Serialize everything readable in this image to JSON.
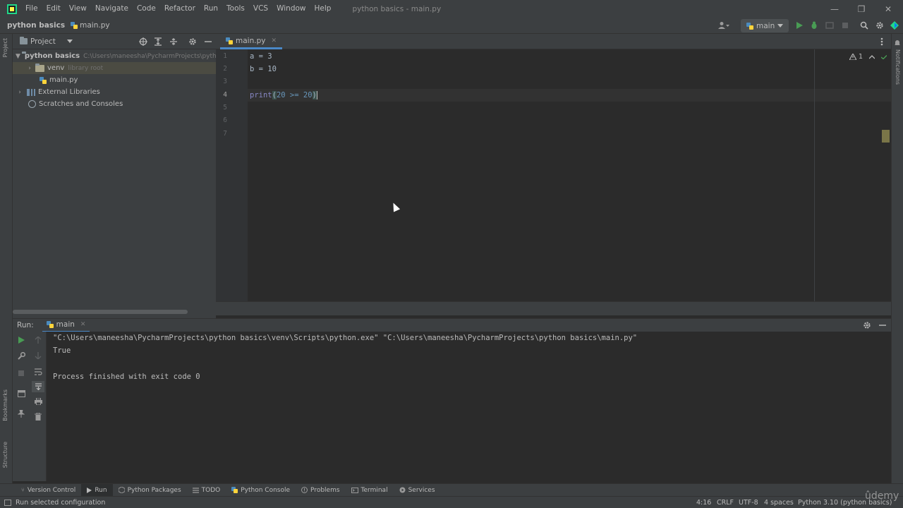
{
  "menubar": {
    "items": [
      "File",
      "Edit",
      "View",
      "Navigate",
      "Code",
      "Refactor",
      "Run",
      "Tools",
      "VCS",
      "Window",
      "Help"
    ],
    "window_title": "python basics - main.py",
    "minimize_glyph": "—",
    "restore_glyph": "❐",
    "close_glyph": "✕"
  },
  "navbar": {
    "project": "python basics",
    "file": "main.py",
    "run_config": "main",
    "icons": [
      "user-icon",
      "run-icon",
      "debug-icon",
      "coverage-icon",
      "stop-icon",
      "search-icon",
      "gear-icon",
      "jetbrains-icon"
    ]
  },
  "project_panel": {
    "title": "Project",
    "tree": [
      {
        "label": "python basics",
        "hint": "C:\\Users\\maneesha\\PycharmProjects\\pyth"
      },
      {
        "label": "venv",
        "hint": "library root"
      },
      {
        "label": "main.py",
        "hint": ""
      },
      {
        "label": "External Libraries",
        "hint": ""
      },
      {
        "label": "Scratches and Consoles",
        "hint": ""
      }
    ]
  },
  "left_stripe": {
    "project": "Project",
    "bookmarks": "Bookmarks",
    "structure": "Structure"
  },
  "right_stripe": {
    "notifications": "Notifications"
  },
  "editor": {
    "tab": "main.py",
    "line_numbers": [
      "1",
      "2",
      "3",
      "4",
      "5",
      "6",
      "7"
    ],
    "inspection_count": "1",
    "lines": {
      "l1": "a = 3",
      "l2": "b = 10",
      "l4_fn": "print",
      "l4_open": "(",
      "l4_expr": "20 >= 20",
      "l4_close": ")"
    }
  },
  "run_panel": {
    "label": "Run:",
    "tab": "main",
    "output": [
      "\"C:\\Users\\maneesha\\PycharmProjects\\python basics\\venv\\Scripts\\python.exe\" \"C:\\Users\\maneesha\\PycharmProjects\\python basics\\main.py\"",
      "True",
      "",
      "Process finished with exit code 0"
    ]
  },
  "tool_tabs": [
    "Version Control",
    "Run",
    "Python Packages",
    "TODO",
    "Python Console",
    "Problems",
    "Terminal",
    "Services"
  ],
  "statusbar": {
    "message": "Run selected configuration",
    "position": "4:16",
    "line_sep": "CRLF",
    "encoding": "UTF-8",
    "indent": "4 spaces",
    "interpreter": "Python 3.10 (python basics)"
  },
  "watermark": "ûdemy",
  "colors": {
    "keyword_fn": "#8888c6",
    "number": "#6897bb",
    "accent": "#4a88c7"
  }
}
